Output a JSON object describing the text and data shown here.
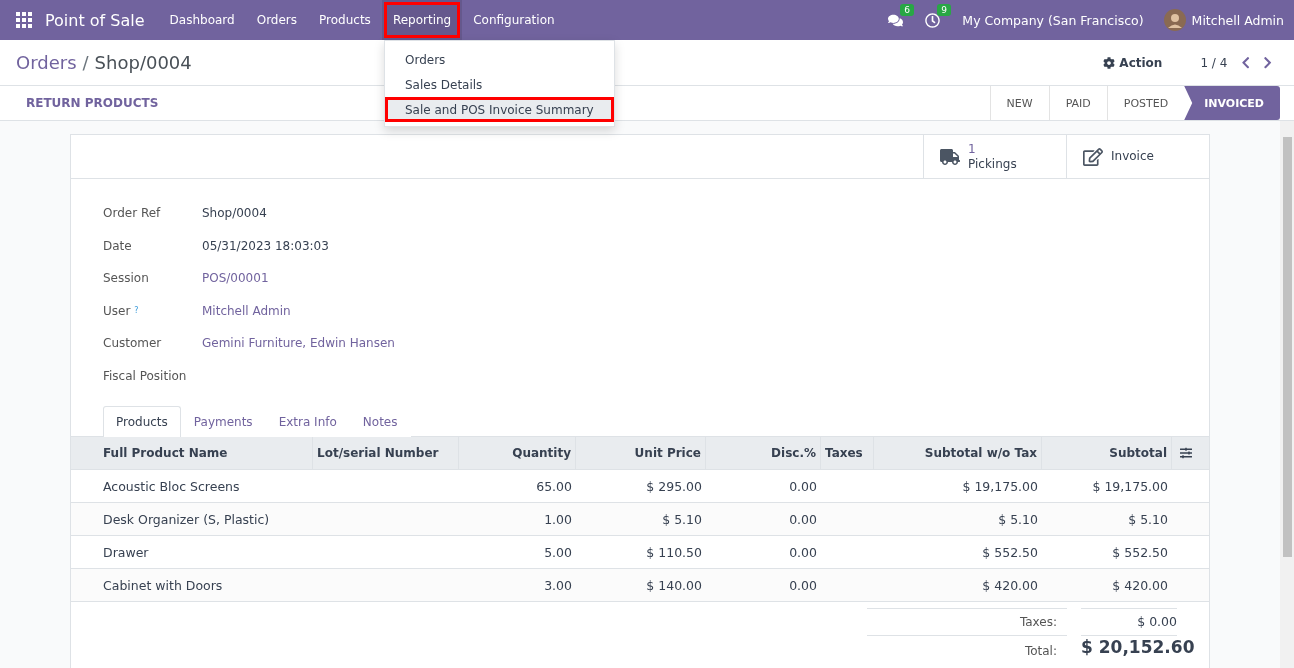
{
  "navbar": {
    "app_title": "Point of Sale",
    "menu": [
      {
        "label": "Dashboard",
        "selected": false,
        "highlighted": false
      },
      {
        "label": "Orders",
        "selected": false,
        "highlighted": false
      },
      {
        "label": "Products",
        "selected": false,
        "highlighted": false
      },
      {
        "label": "Reporting",
        "selected": true,
        "highlighted": true
      },
      {
        "label": "Configuration",
        "selected": false,
        "highlighted": false
      }
    ],
    "messages_count": "6",
    "activities_count": "9",
    "company": "My Company (San Francisco)",
    "user": "Mitchell Admin"
  },
  "dropdown": {
    "items": [
      {
        "label": "Orders",
        "highlighted": false
      },
      {
        "label": "Sales Details",
        "highlighted": false
      },
      {
        "label": "Sale and POS Invoice Summary",
        "highlighted": true
      }
    ]
  },
  "breadcrumb": {
    "parent": "Orders",
    "separator": "/",
    "current": "Shop/0004"
  },
  "action": "Action",
  "pager": "1 / 4",
  "return_button": "RETURN PRODUCTS",
  "status_steps": [
    {
      "label": "NEW",
      "selected": false
    },
    {
      "label": "PAID",
      "selected": false
    },
    {
      "label": "POSTED",
      "selected": false
    },
    {
      "label": "INVOICED",
      "selected": true
    }
  ],
  "smart_buttons": [
    {
      "kind": "pickings",
      "value": "1",
      "label": "Pickings"
    },
    {
      "kind": "invoice",
      "label": "Invoice"
    }
  ],
  "fields": [
    {
      "label": "Order Ref",
      "value": "Shop/0004",
      "link": false
    },
    {
      "label": "Date",
      "value": "05/31/2023 18:03:03",
      "link": false
    },
    {
      "label": "Session",
      "value": "POS/00001",
      "link": true
    },
    {
      "label": "User",
      "help": "?",
      "value": "Mitchell Admin",
      "link": true
    },
    {
      "label": "Customer",
      "value": "Gemini Furniture, Edwin Hansen",
      "link": true
    },
    {
      "label": "Fiscal Position"
    }
  ],
  "tabs": [
    {
      "label": "Products",
      "selected": true
    },
    {
      "label": "Payments",
      "selected": false
    },
    {
      "label": "Extra Info",
      "selected": false
    },
    {
      "label": "Notes",
      "selected": false
    }
  ],
  "table": {
    "columns": [
      "Full Product Name",
      "Lot/serial Number",
      "Quantity",
      "Unit Price",
      "Disc.%",
      "Taxes",
      "Subtotal w/o Tax",
      "Subtotal"
    ],
    "rows": [
      [
        "Acoustic Bloc Screens",
        "",
        "65.00",
        "$ 295.00",
        "0.00",
        "",
        "$ 19,175.00",
        "$ 19,175.00"
      ],
      [
        "Desk Organizer (S, Plastic)",
        "",
        "1.00",
        "$ 5.10",
        "0.00",
        "",
        "$ 5.10",
        "$ 5.10"
      ],
      [
        "Drawer",
        "",
        "5.00",
        "$ 110.50",
        "0.00",
        "",
        "$ 552.50",
        "$ 552.50"
      ],
      [
        "Cabinet with Doors",
        "",
        "3.00",
        "$ 140.00",
        "0.00",
        "",
        "$ 420.00",
        "$ 420.00"
      ]
    ]
  },
  "totals": [
    {
      "label": "Taxes:",
      "value": "$ 0.00"
    },
    {
      "label": "Total:",
      "value": "$ 20,152.60"
    }
  ]
}
